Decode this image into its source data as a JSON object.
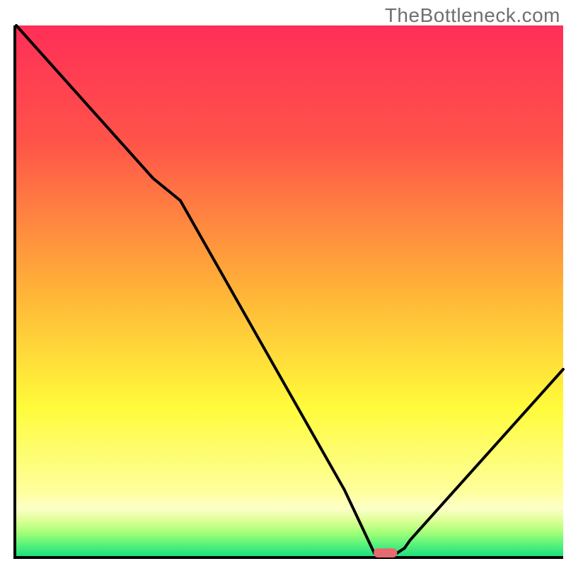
{
  "watermark": "TheBottleneck.com",
  "chart_data": {
    "type": "line",
    "title": "",
    "xlabel": "",
    "ylabel": "",
    "xlim": [
      0,
      100
    ],
    "ylim": [
      0,
      100
    ],
    "grid": false,
    "legend": false,
    "series": [
      {
        "name": "bottleneck-curve",
        "color": "#000000",
        "x": [
          0,
          25,
          30,
          60,
          65.5,
          69.5,
          71,
          72,
          100
        ],
        "values": [
          103.5,
          71.2,
          67,
          12.5,
          0.5,
          0.5,
          1.5,
          3,
          35.2
        ]
      }
    ],
    "marker": {
      "name": "optimal-marker",
      "x_center": 67.5,
      "width": 4.3,
      "y": 0.6,
      "color": "#e66b6f"
    },
    "background": {
      "gradient_stops": [
        {
          "offset": 0.0,
          "color": "#ff2e58"
        },
        {
          "offset": 0.22,
          "color": "#ff5449"
        },
        {
          "offset": 0.5,
          "color": "#ffb338"
        },
        {
          "offset": 0.72,
          "color": "#fffb3b"
        },
        {
          "offset": 0.88,
          "color": "#feff9e"
        },
        {
          "offset": 0.91,
          "color": "#fdffc7"
        },
        {
          "offset": 0.935,
          "color": "#d9ff93"
        },
        {
          "offset": 0.955,
          "color": "#a6ff78"
        },
        {
          "offset": 0.975,
          "color": "#63f47a"
        },
        {
          "offset": 1.0,
          "color": "#1ce07d"
        }
      ]
    },
    "axes": {
      "left": {
        "x": 2.5
      },
      "bottom": {
        "y": 0
      }
    }
  }
}
